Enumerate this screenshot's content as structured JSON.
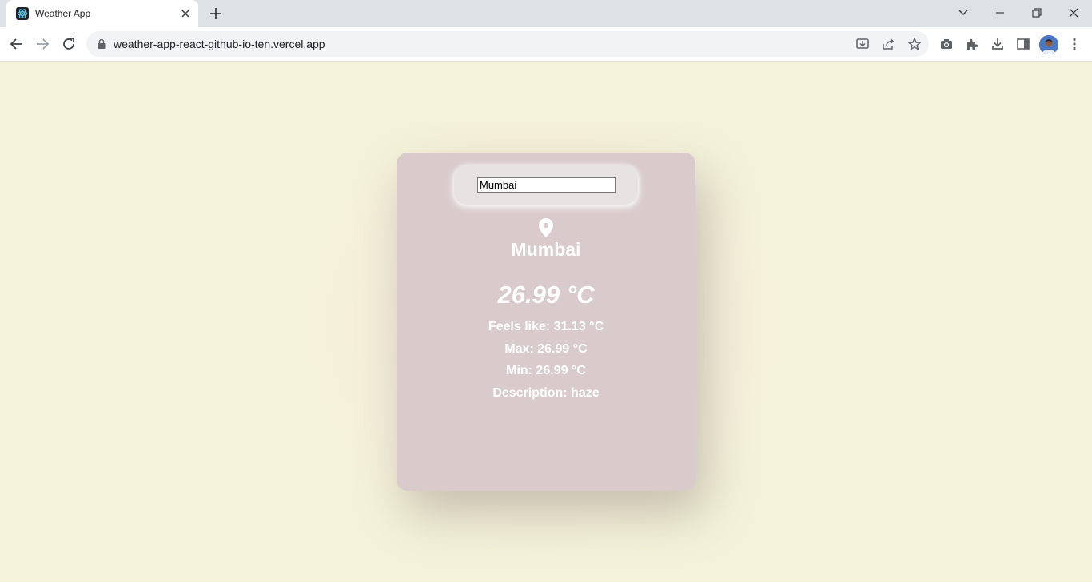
{
  "browser": {
    "tab_title": "Weather App",
    "url": "weather-app-react-github-io-ten.vercel.app"
  },
  "weather": {
    "search_value": "Mumbai",
    "city": "Mumbai",
    "temperature": "26.99 °C",
    "feels_like": "Feels like: 31.13 °C",
    "max": "Max: 26.99 °C",
    "min": "Min: 26.99 °C",
    "description": "Description: haze"
  },
  "colors": {
    "page_background": "#f4f3da",
    "card_background": "#d9cbcb",
    "text": "#ffffff"
  },
  "icons": [
    "react-favicon-icon",
    "close-icon",
    "plus-icon",
    "chevron-down-icon",
    "minimize-icon",
    "restore-icon",
    "window-close-icon",
    "back-icon",
    "forward-icon",
    "reload-icon",
    "lock-icon",
    "install-icon",
    "share-icon",
    "star-icon",
    "camera-icon",
    "extensions-icon",
    "download-icon",
    "side-panel-icon",
    "menu-icon",
    "location-pin-icon"
  ]
}
